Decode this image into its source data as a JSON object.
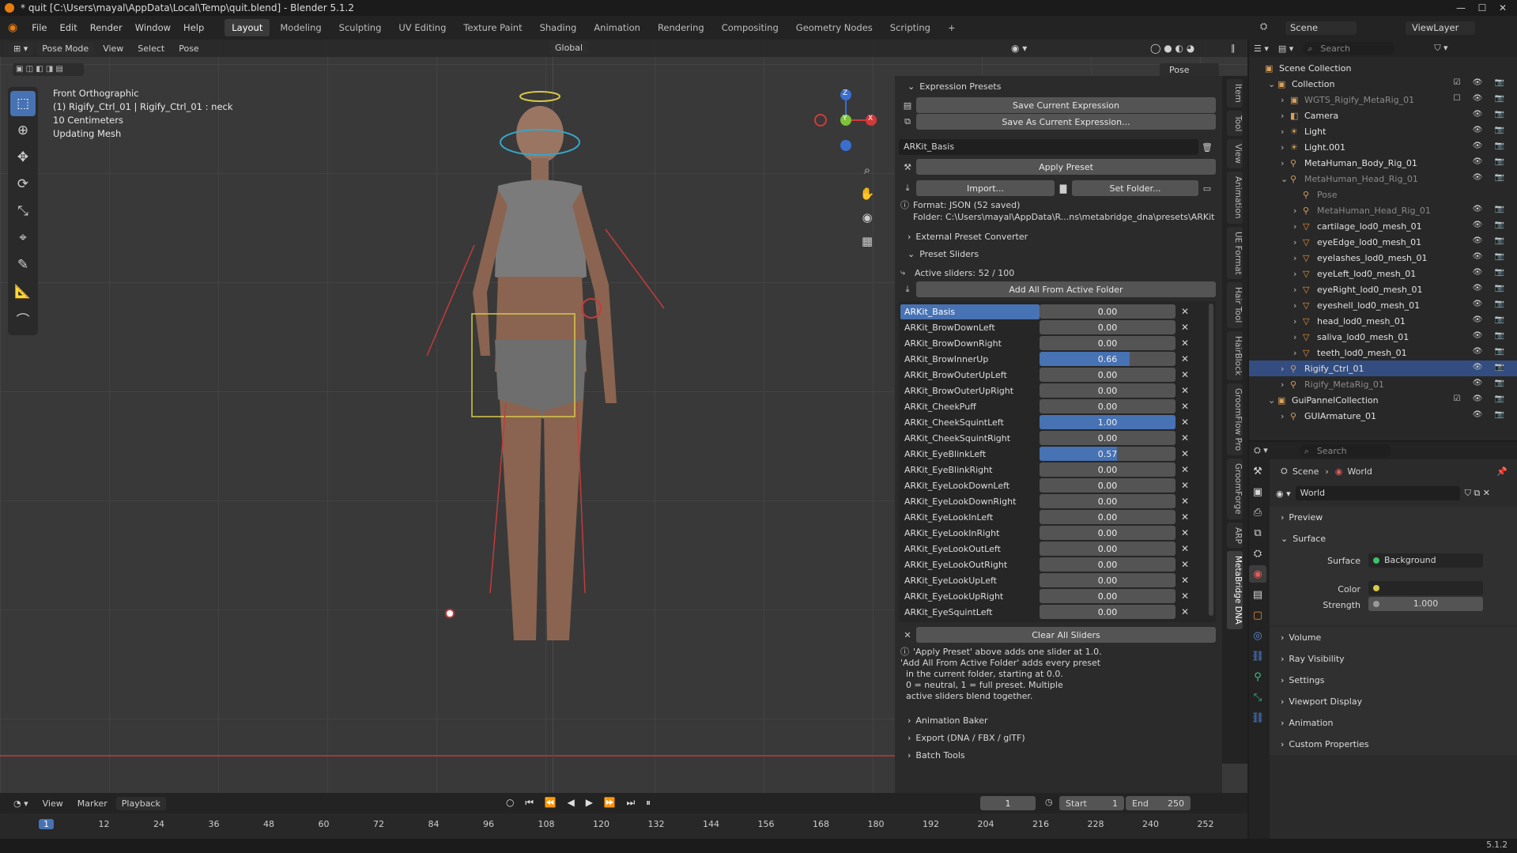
{
  "window": {
    "title": "* quit [C:\\Users\\mayal\\AppData\\Local\\Temp\\quit.blend] - Blender 5.1.2",
    "min": "—",
    "max": "☐",
    "close": "✕"
  },
  "menu": [
    "File",
    "Edit",
    "Render",
    "Window",
    "Help"
  ],
  "workspaces": [
    "Layout",
    "Modeling",
    "Sculpting",
    "UV Editing",
    "Texture Paint",
    "Shading",
    "Animation",
    "Rendering",
    "Compositing",
    "Geometry Nodes",
    "Scripting"
  ],
  "workspace_add": "+",
  "scene": "Scene",
  "viewlayer": "ViewLayer",
  "viewport": {
    "mode": "Pose Mode",
    "menus": [
      "View",
      "Select",
      "Pose"
    ],
    "transform": "Global",
    "pose_options": "Pose Options",
    "info": [
      "Front Orthographic",
      "(1) Rigify_Ctrl_01 | Rigify_Ctrl_01 : neck",
      "10 Centimeters",
      "Updating Mesh"
    ],
    "axis": {
      "z": "Z",
      "y": "Y",
      "x": "X"
    }
  },
  "npanel": {
    "expression_presets": "Expression Presets",
    "save_current": "Save Current Expression",
    "save_as": "Save As Current Expression...",
    "preset_select": "ARKit_Basis",
    "apply_preset": "Apply Preset",
    "import": "Import...",
    "set_folder": "Set Folder...",
    "format": "Format: JSON  (52 saved)",
    "folder": "Folder: C:\\Users\\mayal\\AppData\\R...ns\\metabridge_dna\\presets\\ARKit",
    "external_converter": "External Preset Converter",
    "preset_sliders": "Preset Sliders",
    "active_sliders": "Active sliders: 52 / 100",
    "add_all": "Add All From Active Folder",
    "sliders": [
      {
        "name": "ARKit_Basis",
        "value": "0.00",
        "fill": 0,
        "selected": true
      },
      {
        "name": "ARKit_BrowDownLeft",
        "value": "0.00",
        "fill": 0
      },
      {
        "name": "ARKit_BrowDownRight",
        "value": "0.00",
        "fill": 0
      },
      {
        "name": "ARKit_BrowInnerUp",
        "value": "0.66",
        "fill": 0.66
      },
      {
        "name": "ARKit_BrowOuterUpLeft",
        "value": "0.00",
        "fill": 0
      },
      {
        "name": "ARKit_BrowOuterUpRight",
        "value": "0.00",
        "fill": 0
      },
      {
        "name": "ARKit_CheekPuff",
        "value": "0.00",
        "fill": 0
      },
      {
        "name": "ARKit_CheekSquintLeft",
        "value": "1.00",
        "fill": 1
      },
      {
        "name": "ARKit_CheekSquintRight",
        "value": "0.00",
        "fill": 0
      },
      {
        "name": "ARKit_EyeBlinkLeft",
        "value": "0.57",
        "fill": 0.57
      },
      {
        "name": "ARKit_EyeBlinkRight",
        "value": "0.00",
        "fill": 0
      },
      {
        "name": "ARKit_EyeLookDownLeft",
        "value": "0.00",
        "fill": 0
      },
      {
        "name": "ARKit_EyeLookDownRight",
        "value": "0.00",
        "fill": 0
      },
      {
        "name": "ARKit_EyeLookInLeft",
        "value": "0.00",
        "fill": 0
      },
      {
        "name": "ARKit_EyeLookInRight",
        "value": "0.00",
        "fill": 0
      },
      {
        "name": "ARKit_EyeLookOutLeft",
        "value": "0.00",
        "fill": 0
      },
      {
        "name": "ARKit_EyeLookOutRight",
        "value": "0.00",
        "fill": 0
      },
      {
        "name": "ARKit_EyeLookUpLeft",
        "value": "0.00",
        "fill": 0
      },
      {
        "name": "ARKit_EyeLookUpRight",
        "value": "0.00",
        "fill": 0
      },
      {
        "name": "ARKit_EyeSquintLeft",
        "value": "0.00",
        "fill": 0
      }
    ],
    "clear_all": "Clear All Sliders",
    "help": [
      "'Apply Preset' above adds one slider at 1.0.",
      "'Add All From Active Folder' adds every preset",
      "  in the current folder, starting at 0.0.",
      "  0 = neutral, 1 = full preset. Multiple",
      "  active sliders blend together."
    ],
    "animation_baker": "Animation Baker",
    "export": "Export (DNA / FBX / glTF)",
    "batch_tools": "Batch Tools"
  },
  "vtabs": [
    "Item",
    "Tool",
    "View",
    "Animation",
    "UE Format",
    "Hair Tool",
    "HairBlock",
    "GroomFlow Pro",
    "GroomForge",
    "ARP",
    "MetaBridge DNA"
  ],
  "timeline": {
    "menus": [
      "View",
      "Marker",
      "Playback"
    ],
    "current_frame": "1",
    "start_label": "Start",
    "start": "1",
    "end_label": "End",
    "end": "250",
    "ticks": [
      "1",
      "12",
      "24",
      "36",
      "48",
      "60",
      "72",
      "84",
      "96",
      "108",
      "120",
      "132",
      "144",
      "156",
      "168",
      "180",
      "192",
      "204",
      "216",
      "228",
      "240",
      "252"
    ]
  },
  "outliner": {
    "search": "Search",
    "items": [
      {
        "label": "Scene Collection",
        "depth": 0,
        "icon": "▣"
      },
      {
        "label": "Collection",
        "depth": 1,
        "icon": "▣",
        "arrow": "⌄"
      },
      {
        "label": "WGTS_Rigify_MetaRig_01",
        "depth": 2,
        "icon": "▣",
        "arrow": "›",
        "dim": true
      },
      {
        "label": "Camera",
        "depth": 2,
        "icon": "◧",
        "arrow": "›"
      },
      {
        "label": "Light",
        "depth": 2,
        "icon": "☀",
        "arrow": "›"
      },
      {
        "label": "Light.001",
        "depth": 2,
        "icon": "☀",
        "arrow": "›"
      },
      {
        "label": "MetaHuman_Body_Rig_01",
        "depth": 2,
        "icon": "⚲",
        "arrow": "›"
      },
      {
        "label": "MetaHuman_Head_Rig_01",
        "depth": 2,
        "icon": "⚲",
        "arrow": "⌄",
        "dim": true
      },
      {
        "label": "Pose",
        "depth": 3,
        "icon": "⚲",
        "dim": true
      },
      {
        "label": "MetaHuman_Head_Rig_01",
        "depth": 3,
        "icon": "⚲",
        "arrow": "›",
        "dim": true
      },
      {
        "label": "cartilage_lod0_mesh_01",
        "depth": 3,
        "icon": "▽",
        "arrow": "›"
      },
      {
        "label": "eyeEdge_lod0_mesh_01",
        "depth": 3,
        "icon": "▽",
        "arrow": "›"
      },
      {
        "label": "eyelashes_lod0_mesh_01",
        "depth": 3,
        "icon": "▽",
        "arrow": "›"
      },
      {
        "label": "eyeLeft_lod0_mesh_01",
        "depth": 3,
        "icon": "▽",
        "arrow": "›"
      },
      {
        "label": "eyeRight_lod0_mesh_01",
        "depth": 3,
        "icon": "▽",
        "arrow": "›"
      },
      {
        "label": "eyeshell_lod0_mesh_01",
        "depth": 3,
        "icon": "▽",
        "arrow": "›"
      },
      {
        "label": "head_lod0_mesh_01",
        "depth": 3,
        "icon": "▽",
        "arrow": "›"
      },
      {
        "label": "saliva_lod0_mesh_01",
        "depth": 3,
        "icon": "▽",
        "arrow": "›"
      },
      {
        "label": "teeth_lod0_mesh_01",
        "depth": 3,
        "icon": "▽",
        "arrow": "›"
      },
      {
        "label": "Rigify_Ctrl_01",
        "depth": 2,
        "icon": "⚲",
        "arrow": "›",
        "selected": true
      },
      {
        "label": "Rigify_MetaRig_01",
        "depth": 2,
        "icon": "⚲",
        "arrow": "›",
        "dim": true
      },
      {
        "label": "GuiPannelCollection",
        "depth": 1,
        "icon": "▣",
        "arrow": "⌄"
      },
      {
        "label": "GUIArmature_01",
        "depth": 2,
        "icon": "⚲",
        "arrow": "›"
      }
    ]
  },
  "properties": {
    "search": "Search",
    "breadcrumb_scene": "Scene",
    "breadcrumb_world": "World",
    "world_name": "World",
    "panels": {
      "preview": "Preview",
      "surface": "Surface",
      "volume": "Volume",
      "ray_visibility": "Ray Visibility",
      "settings": "Settings",
      "viewport_display": "Viewport Display",
      "animation": "Animation",
      "custom_properties": "Custom Properties"
    },
    "surface_label": "Surface",
    "surface_value": "Background",
    "color_label": "Color",
    "strength_label": "Strength",
    "strength_value": "1.000"
  },
  "version": "5.1.2",
  "colors": {
    "accent": "#4772b3",
    "bone": "#d23a3a",
    "selection": "#d8c94a"
  }
}
